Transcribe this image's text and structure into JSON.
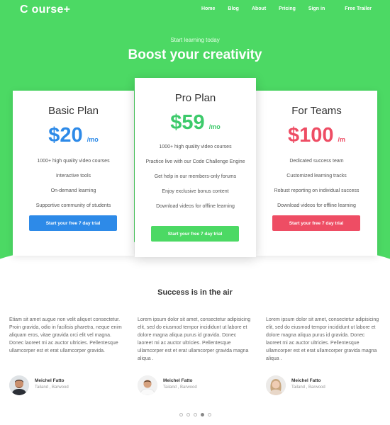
{
  "nav": {
    "logo": "C ourse+",
    "links": [
      "Home",
      "Blog",
      "About",
      "Pricing",
      "Sign in"
    ],
    "trailer": "Free Trailer"
  },
  "hero": {
    "subtitle": "Start learning today",
    "title": "Boost your creativity"
  },
  "plans": [
    {
      "name": "Basic Plan",
      "price": "$20",
      "per": "/mo",
      "color": "#2d8ae8",
      "features": [
        "1000+ high quality video courses",
        "Interactive tools",
        "On-demand learning",
        "Supportive community of students"
      ],
      "cta": "Start your free 7 day trial"
    },
    {
      "name": "Pro Plan",
      "price": "$59",
      "per": "/mo",
      "color": "#3dca6b",
      "features": [
        "1000+ high quality video courses",
        "Practice live with our Code Challenge Engine",
        "Get help in our members-only forums",
        "Enjoy exclusive bonus content",
        "Download videos for offline learning"
      ],
      "cta": "Start your free 7 day trial"
    },
    {
      "name": "For Teams",
      "price": "$100",
      "per": "/m",
      "color": "#ee4d64",
      "features": [
        "Dedicated success team",
        "Customized learning tracks",
        "Robust reporting on individual success",
        "Download videos for offline learning"
      ],
      "cta": "Start your free 7 day trial"
    }
  ],
  "testimonials": {
    "title": "Success is in the air",
    "items": [
      {
        "quote": "Etiam sit amet augue non velit aliquet consectetur. Proin gravida, odio in facilisis pharetra, neque enim aliquam eros, vitae gravida orci elit vel magna. Donec laoreet mi ac auctor ultricies. Pellentesque ullamcorper est et erat ullamcorper gravida.",
        "name": "Meichel Fatto",
        "location": "Tailand , Barwood"
      },
      {
        "quote": "Lorem ipsum dolor sit amet, consectetur adipisicing elit, sed do eiusmod tempor incididunt ut labore et dolore magna aliqua purus id gravida. Donec laoreet mi ac auctor ultricies. Pellentesque ullamcorper est et erat ullamcorper gravida magna aliqua .",
        "name": "Meichel Fatto",
        "location": "Tailand , Barwood"
      },
      {
        "quote": "Lorem ipsum dolor sit amet, consectetur adipisicing elit, sed do eiusmod tempor incididunt ut labore et dolore magna aliqua purus id gravida. Donec laoreet mi ac auctor ultricies. Pellentesque ullamcorper est et erat ullamcorper gravida magna aliqua .",
        "name": "Meichel Fatto",
        "location": "Tailand , Barwood"
      }
    ],
    "carousel_active_index": 3,
    "carousel_count": 5
  },
  "colors": {
    "hero_green": "#4cd964",
    "basic_blue": "#2d8ae8",
    "pro_green": "#3dca6b",
    "teams_red": "#ee4d64"
  }
}
